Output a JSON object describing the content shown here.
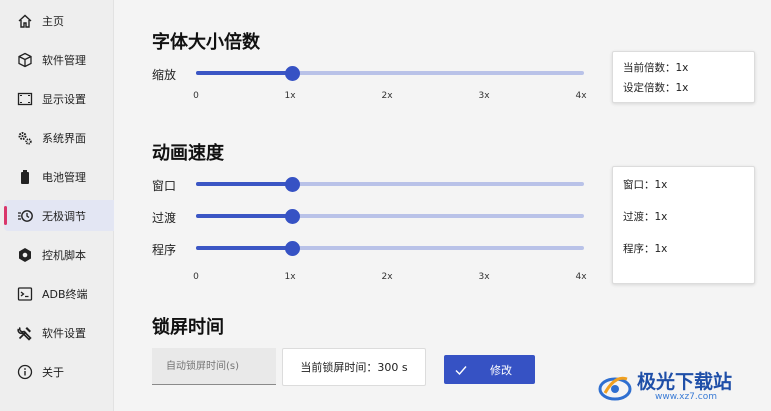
{
  "sidebar": {
    "items": [
      {
        "label": "主页",
        "icon": "home-icon"
      },
      {
        "label": "软件管理",
        "icon": "cube-icon"
      },
      {
        "label": "显示设置",
        "icon": "display-icon"
      },
      {
        "label": "系统界面",
        "icon": "gears-icon"
      },
      {
        "label": "电池管理",
        "icon": "battery-icon"
      },
      {
        "label": "无极调节",
        "icon": "timer-icon",
        "active": true
      },
      {
        "label": "控机脚本",
        "icon": "hexagon-icon"
      },
      {
        "label": "ADB终端",
        "icon": "terminal-icon"
      },
      {
        "label": "软件设置",
        "icon": "tools-icon"
      },
      {
        "label": "关于",
        "icon": "info-icon"
      }
    ]
  },
  "font_scale": {
    "title": "字体大小倍数",
    "slider_label": "缩放",
    "value": "1x",
    "ticks": [
      "0",
      "1x",
      "2x",
      "3x",
      "4x"
    ],
    "info_current": "当前倍数：1x",
    "info_set": "设定倍数：1x"
  },
  "animation": {
    "title": "动画速度",
    "sliders": [
      {
        "label": "窗口",
        "value": "1x"
      },
      {
        "label": "过渡",
        "value": "1x"
      },
      {
        "label": "程序",
        "value": "1x"
      }
    ],
    "ticks": [
      "0",
      "1x",
      "2x",
      "3x",
      "4x"
    ],
    "info": [
      "窗口：1x",
      "过渡：1x",
      "程序：1x"
    ]
  },
  "lock_screen": {
    "title": "锁屏时间",
    "input_placeholder": "自动锁屏时间(s)",
    "current": "当前锁屏时间：300 s",
    "button_label": "修改"
  },
  "watermark": {
    "name": "极光下载站",
    "url": "www.xz7.com"
  },
  "colors": {
    "accent": "#3652c4",
    "track": "#b9c2e8",
    "active_marker": "#d9366b"
  }
}
